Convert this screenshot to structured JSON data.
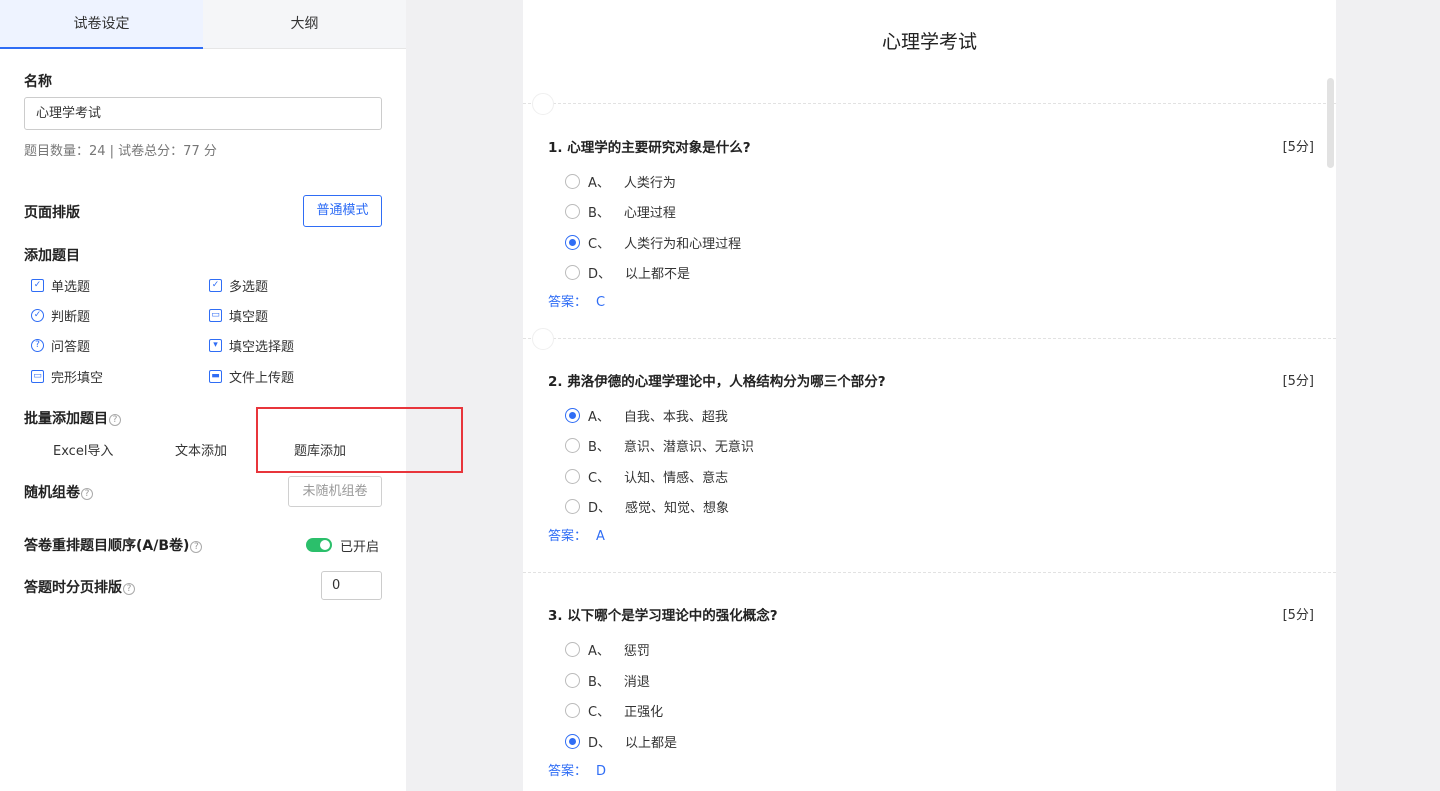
{
  "tabs": [
    {
      "label": "试卷设定",
      "active": true
    },
    {
      "label": "大纲",
      "active": false
    }
  ],
  "settings": {
    "name_label": "名称",
    "name_value": "心理学考试",
    "summary": "题目数量：24 | 试卷总分：77 分",
    "layout_label": "页面排版",
    "layout_button": "普通模式",
    "add_label": "添加题目",
    "question_types": [
      {
        "label": "单选题",
        "icon": "checkbox-icon"
      },
      {
        "label": "多选题",
        "icon": "multi-checkbox-icon"
      },
      {
        "label": "判断题",
        "icon": "check-circle-icon"
      },
      {
        "label": "填空题",
        "icon": "blank-fill-icon"
      },
      {
        "label": "问答题",
        "icon": "question-circle-icon"
      },
      {
        "label": "填空选择题",
        "icon": "dropdown-fill-icon"
      },
      {
        "label": "完形填空",
        "icon": "cloze-icon"
      },
      {
        "label": "文件上传题",
        "icon": "folder-icon"
      }
    ],
    "batch_label": "批量添加题目",
    "batch_options": [
      "Excel导入",
      "文本添加",
      "题库添加"
    ],
    "random_label": "随机组卷",
    "random_button": "未随机组卷",
    "reorder_label": "答卷重排题目顺序(A/B卷)",
    "reorder_status": "已开启",
    "reorder_on": true,
    "paging_label": "答题时分页排版",
    "paging_value": "0",
    "help_glyph": "?"
  },
  "paper": {
    "title": "心理学考试",
    "answer_label": "答案：",
    "questions": [
      {
        "title": "1. 心理学的主要研究对象是什么?",
        "score": "[5分]",
        "options": [
          {
            "letter": "A、",
            "text": "人类行为",
            "selected": false
          },
          {
            "letter": "B、",
            "text": "心理过程",
            "selected": false
          },
          {
            "letter": "C、",
            "text": "人类行为和心理过程",
            "selected": true
          },
          {
            "letter": "D、",
            "text": "以上都不是",
            "selected": false
          }
        ],
        "answer": "C"
      },
      {
        "title": "2. 弗洛伊德的心理学理论中，人格结构分为哪三个部分?",
        "score": "[5分]",
        "options": [
          {
            "letter": "A、",
            "text": "自我、本我、超我",
            "selected": true
          },
          {
            "letter": "B、",
            "text": "意识、潜意识、无意识",
            "selected": false
          },
          {
            "letter": "C、",
            "text": "认知、情感、意志",
            "selected": false
          },
          {
            "letter": "D、",
            "text": "感觉、知觉、想象",
            "selected": false
          }
        ],
        "answer": "A"
      },
      {
        "title": "3. 以下哪个是学习理论中的强化概念?",
        "score": "[5分]",
        "options": [
          {
            "letter": "A、",
            "text": "惩罚",
            "selected": false
          },
          {
            "letter": "B、",
            "text": "消退",
            "selected": false
          },
          {
            "letter": "C、",
            "text": "正强化",
            "selected": false
          },
          {
            "letter": "D、",
            "text": "以上都是",
            "selected": true
          }
        ],
        "answer": "D"
      }
    ]
  },
  "colors": {
    "accent": "#2f6df5",
    "highlight_box": "#e8353b",
    "toggle_on": "#2bbf6b"
  }
}
